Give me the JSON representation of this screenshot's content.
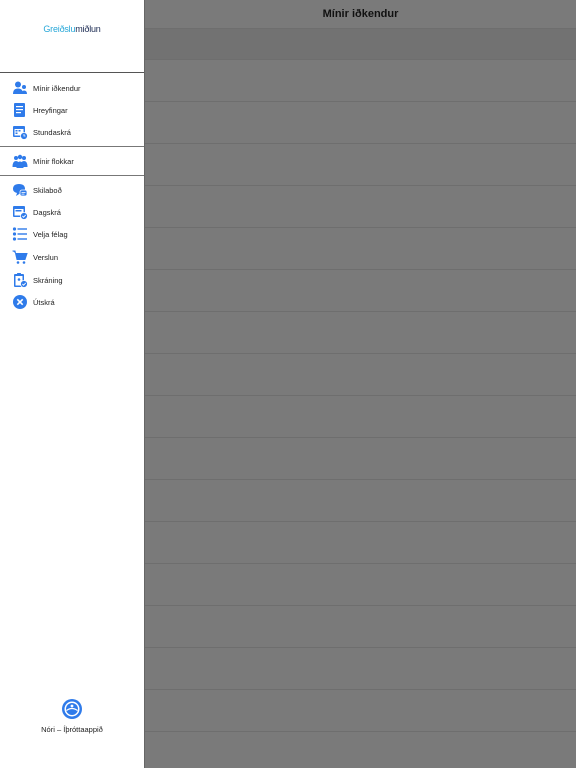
{
  "header": {
    "title": "Mínir iðkendur"
  },
  "logo": {
    "part1": "Greiðslu",
    "part2": "miðlun"
  },
  "menu": {
    "group1": [
      {
        "label": "Mínir iðkendur",
        "icon": "users-icon"
      },
      {
        "label": "Hreyfingar",
        "icon": "ledger-icon"
      },
      {
        "label": "Stundaskrá",
        "icon": "calendar-clock-icon"
      }
    ],
    "group2": [
      {
        "label": "Mínir flokkar",
        "icon": "group-icon"
      }
    ],
    "group3": [
      {
        "label": "Skilaboð",
        "icon": "chat-icon"
      },
      {
        "label": "Dagskrá",
        "icon": "calendar-check-icon"
      },
      {
        "label": "Velja félag",
        "icon": "list-icon"
      },
      {
        "label": "Verslun",
        "icon": "cart-icon"
      },
      {
        "label": "Skráning",
        "icon": "clipboard-check-icon"
      },
      {
        "label": "Útskrá",
        "icon": "close-circle-icon"
      }
    ]
  },
  "footer": {
    "label": "Nóri – Íþróttaappið",
    "icon": "app-logo-icon"
  },
  "colors": {
    "accent": "#2f7bea",
    "overlay": "#7a7a7a"
  }
}
